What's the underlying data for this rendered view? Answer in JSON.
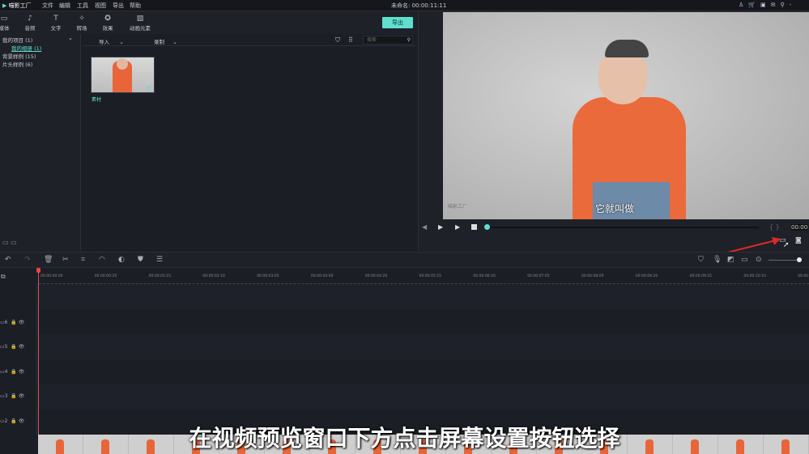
{
  "app": {
    "logo": "喵影工厂",
    "title": "未命名: 00:00:11:11"
  },
  "menu": [
    "文件",
    "编辑",
    "工具",
    "视图",
    "导出",
    "帮助"
  ],
  "toolbar": {
    "tabs": [
      {
        "label": "媒体",
        "icon": "folder-icon"
      },
      {
        "label": "音频",
        "icon": "music-icon"
      },
      {
        "label": "文字",
        "icon": "text-icon"
      },
      {
        "label": "转场",
        "icon": "transition-icon"
      },
      {
        "label": "效果",
        "icon": "effects-icon"
      },
      {
        "label": "动画元素",
        "icon": "elements-icon"
      }
    ],
    "export": "导出"
  },
  "sidebar": {
    "items": [
      "我的项目 (1)",
      "我的相册 (1)",
      "背景样例 (15)",
      "片头样例 (6)"
    ]
  },
  "media": {
    "import": "导入",
    "record": "录制",
    "search_placeholder": "搜索",
    "clip_label": "素材"
  },
  "preview": {
    "caption": "它就叫做",
    "watermark": "喵影工厂",
    "timecode": "00:00",
    "progress": 0
  },
  "ruler": [
    "00:00:00:00",
    "00:00:00:20",
    "00:00:01:15",
    "00:00:02:10",
    "00:00:03:05",
    "00:00:04:00",
    "00:00:04:20",
    "00:00:05:15",
    "00:00:06:10",
    "00:00:07:05",
    "00:00:08:00",
    "00:00:08:20",
    "00:00:09:15",
    "00:00:10:10",
    "00:00"
  ],
  "tracks": [
    "6",
    "5",
    "4",
    "3",
    "2"
  ],
  "subtitle": "在视频预览窗口下方点击屏幕设置按钮选择",
  "colors": {
    "accent": "#5fe0cf",
    "annotation_arrow": "#e02828",
    "playhead": "#cc5555"
  }
}
